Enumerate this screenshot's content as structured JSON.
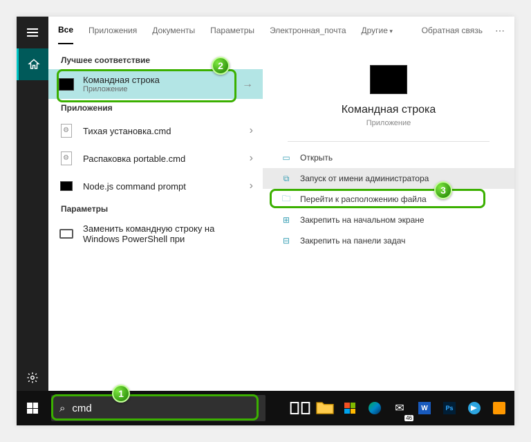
{
  "tabs": {
    "all": "Все",
    "apps": "Приложения",
    "docs": "Документы",
    "settings": "Параметры",
    "email": "Электронная_почта",
    "more": "Другие",
    "feedback": "Обратная связь"
  },
  "sections": {
    "best_match": "Лучшее соответствие",
    "apps": "Приложения",
    "settings": "Параметры"
  },
  "best": {
    "title": "Командная строка",
    "subtitle": "Приложение"
  },
  "apps_list": [
    {
      "title": "Тихая установка.cmd"
    },
    {
      "title": "Распаковка portable.cmd"
    },
    {
      "title": "Node.js command prompt"
    }
  ],
  "settings_list": [
    {
      "title": "Заменить командную строку на Windows PowerShell при"
    }
  ],
  "preview": {
    "title": "Командная строка",
    "subtitle": "Приложение"
  },
  "actions": {
    "open": "Открыть",
    "run_admin": "Запуск от имени администратора",
    "open_location": "Перейти к расположению файла",
    "pin_start": "Закрепить на начальном экране",
    "pin_taskbar": "Закрепить на панели задач"
  },
  "search": {
    "value": "cmd"
  },
  "mail_count": "46",
  "annotations": {
    "b1": "1",
    "b2": "2",
    "b3": "3"
  }
}
